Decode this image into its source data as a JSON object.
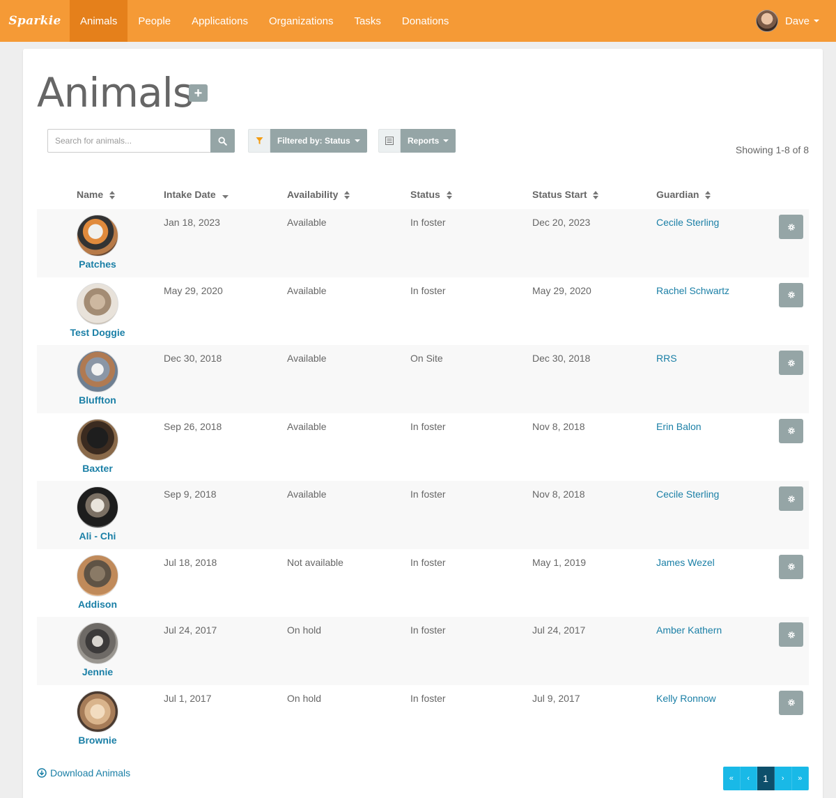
{
  "nav": {
    "brand": "Sparkie",
    "items": [
      {
        "label": "Animals",
        "active": true
      },
      {
        "label": "People",
        "active": false
      },
      {
        "label": "Applications",
        "active": false
      },
      {
        "label": "Organizations",
        "active": false
      },
      {
        "label": "Tasks",
        "active": false
      },
      {
        "label": "Donations",
        "active": false
      }
    ],
    "user": "Dave"
  },
  "page": {
    "title": "Animals",
    "add_label": "+"
  },
  "toolbar": {
    "search_placeholder": "Search for animals...",
    "filter_label": "Filtered by: Status",
    "reports_label": "Reports",
    "showing": "Showing 1-8 of 8"
  },
  "table": {
    "headers": [
      "Name",
      "Intake Date",
      "Availability",
      "Status",
      "Status Start",
      "Guardian"
    ],
    "rows": [
      {
        "name": "Patches",
        "intake": "Jan 18, 2023",
        "availability": "Available",
        "status": "In foster",
        "status_start": "Dec 20, 2023",
        "guardian": "Cecile Sterling"
      },
      {
        "name": "Test Doggie",
        "intake": "May 29, 2020",
        "availability": "Available",
        "status": "In foster",
        "status_start": "May 29, 2020",
        "guardian": "Rachel Schwartz"
      },
      {
        "name": "Bluffton",
        "intake": "Dec 30, 2018",
        "availability": "Available",
        "status": "On Site",
        "status_start": "Dec 30, 2018",
        "guardian": "RRS"
      },
      {
        "name": "Baxter",
        "intake": "Sep 26, 2018",
        "availability": "Available",
        "status": "In foster",
        "status_start": "Nov 8, 2018",
        "guardian": "Erin Balon"
      },
      {
        "name": "Ali - Chi",
        "intake": "Sep 9, 2018",
        "availability": "Available",
        "status": "In foster",
        "status_start": "Nov 8, 2018",
        "guardian": "Cecile Sterling"
      },
      {
        "name": "Addison",
        "intake": "Jul 18, 2018",
        "availability": "Not available",
        "status": "In foster",
        "status_start": "May 1, 2019",
        "guardian": "James Wezel"
      },
      {
        "name": "Jennie",
        "intake": "Jul 24, 2017",
        "availability": "On hold",
        "status": "In foster",
        "status_start": "Jul 24, 2017",
        "guardian": "Amber Kathern"
      },
      {
        "name": "Brownie",
        "intake": "Jul 1, 2017",
        "availability": "On hold",
        "status": "In foster",
        "status_start": "Jul 9, 2017",
        "guardian": "Kelly Ronnow"
      }
    ]
  },
  "footer": {
    "download_label": "Download Animals",
    "pager": [
      "«",
      "‹",
      "1",
      "›",
      "»"
    ]
  },
  "colors": {
    "nav_bg": "#f59a36",
    "nav_active": "#e5801b",
    "link": "#1a7fa6",
    "button_grey": "#95a5a6",
    "pager": "#19b9e7",
    "pager_current": "#0d4f6b"
  }
}
